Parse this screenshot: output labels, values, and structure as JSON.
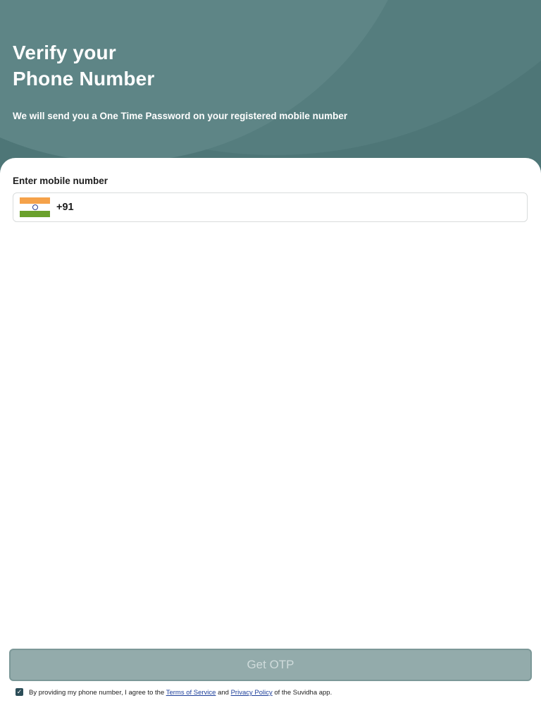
{
  "header": {
    "title_line1": "Verify your",
    "title_line2": "Phone Number",
    "subtitle": "We will send you a One Time Password on your registered mobile number"
  },
  "form": {
    "label": "Enter mobile number",
    "country_code": "+91",
    "flag_icon": "india-flag-icon",
    "phone_value": "",
    "phone_placeholder": ""
  },
  "button": {
    "label": "Get OTP"
  },
  "terms": {
    "checked": true,
    "text_before": "By providing my phone number, I agree to the ",
    "terms_link": "Terms of Service",
    "text_and": " and ",
    "privacy_link": "Privacy Policy",
    "text_after": "  of the Suvidha app."
  },
  "colors": {
    "header_bg": "#4e7677",
    "button_bg": "#93abab",
    "button_text": "#cfdbdb",
    "checkbox": "#2c4d58"
  }
}
